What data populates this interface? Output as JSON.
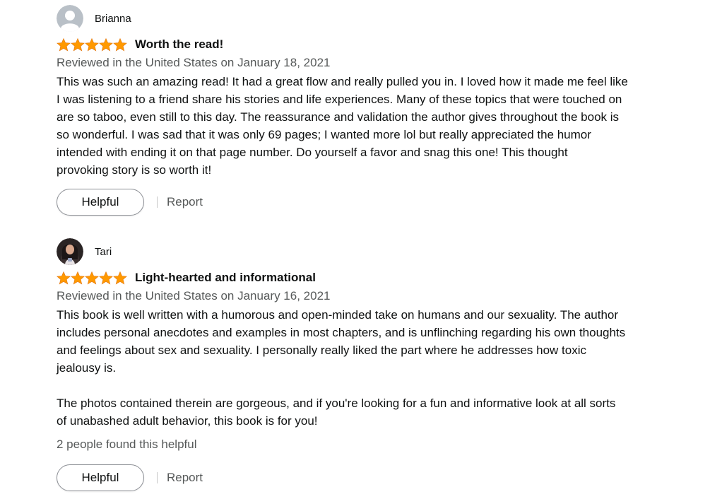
{
  "colors": {
    "star": "#ff9900",
    "text": "#0f1111",
    "muted": "#565959",
    "avatar_placeholder": "#b9c0c7"
  },
  "reviews": [
    {
      "profile_name": "Brianna",
      "avatar_icon": "default-profile-icon",
      "rating": 5,
      "title": "Worth the read!",
      "date": "Reviewed in the United States on January 18, 2021",
      "body_lines": [
        "This was such an amazing read! It had a great flow and really pulled you in. I loved how it made me feel like",
        "I was listening to a friend share his stories and life experiences. Many of these topics that were touched on",
        "are so taboo, even still to this day. The reassurance and validation the author gives throughout the book is",
        "so wonderful. I was sad that it was only 69 pages; I wanted more lol but really appreciated the humor",
        "intended with ending it on that page number. Do yourself a favor and snag this one! This thought",
        "provoking story is so worth it!"
      ],
      "helpful_label": "Helpful",
      "report_label": "Report"
    },
    {
      "profile_name": "Tari",
      "avatar_icon": "profile-photo",
      "rating": 5,
      "title": "Light-hearted and informational",
      "date": "Reviewed in the United States on January 16, 2021",
      "body_lines": [
        "This book is well written with a humorous and open-minded take on humans and our sexuality. The author",
        "includes personal anecdotes and examples in most chapters, and is unflinching regarding his own thoughts",
        "and feelings about sex and sexuality. I personally really liked the part where he addresses how toxic",
        "jealousy is."
      ],
      "body_lines_2": [
        "The photos contained therein are gorgeous, and if you're looking for a fun and informative look at all sorts",
        "of unabashed adult behavior, this book is for you!"
      ],
      "helpful_count": "2 people found this helpful",
      "helpful_label": "Helpful",
      "report_label": "Report"
    }
  ]
}
